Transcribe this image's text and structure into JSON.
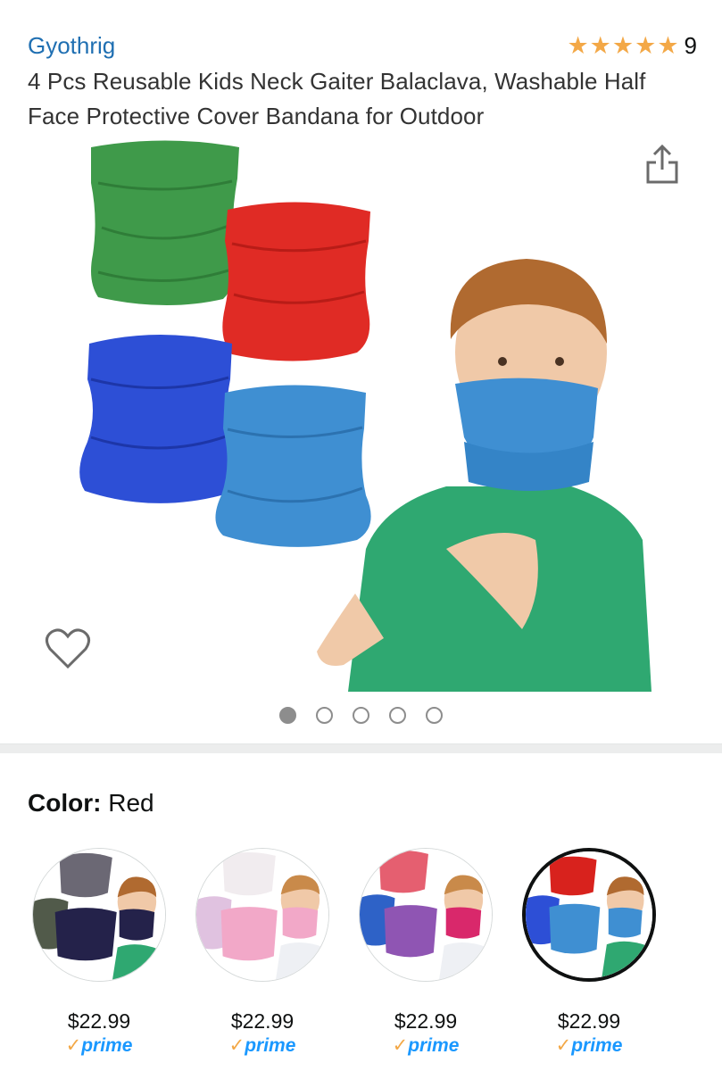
{
  "header": {
    "brand": "Gyothrig",
    "rating_stars": 5,
    "rating_count": "9"
  },
  "product": {
    "title": "4 Pcs Reusable Kids Neck Gaiter Balaclava, Washable Half Face Protective Cover Bandana for Outdoor"
  },
  "gallery": {
    "image_count": 5,
    "active_index": 0
  },
  "variant": {
    "label": "Color:",
    "value": "Red"
  },
  "swatches": [
    {
      "price": "$22.99",
      "prime": "prime",
      "selected": false
    },
    {
      "price": "$22.99",
      "prime": "prime",
      "selected": false
    },
    {
      "price": "$22.99",
      "prime": "prime",
      "selected": false
    },
    {
      "price": "$22.99",
      "prime": "prime",
      "selected": true
    }
  ],
  "colors": {
    "brand_link": "#1f6fb2",
    "star": "#f3a847",
    "prime": "#1a98ff"
  }
}
